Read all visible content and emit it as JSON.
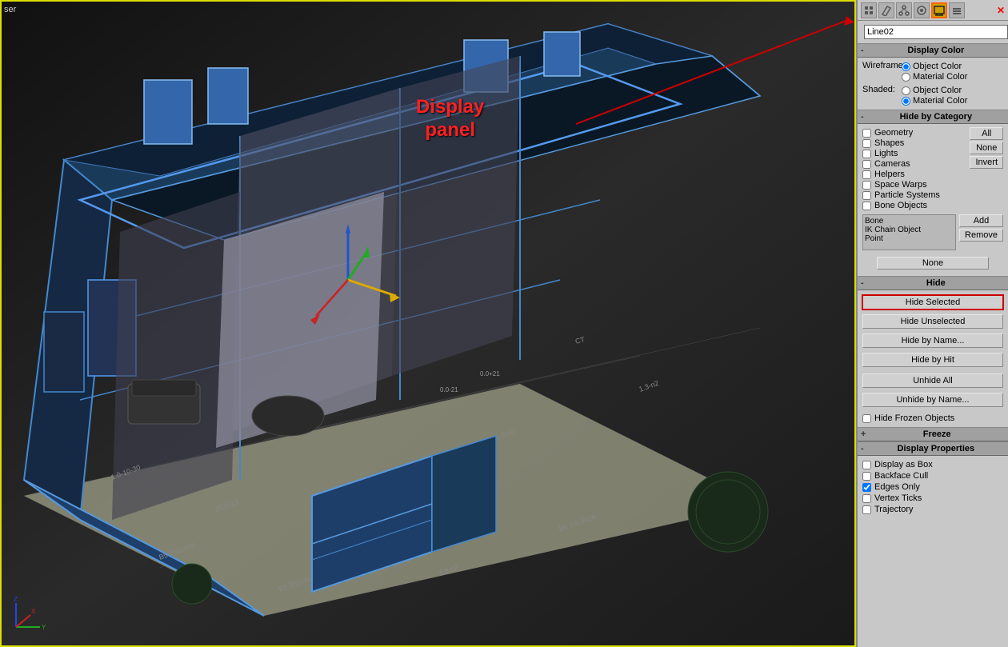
{
  "viewport": {
    "label": "ser"
  },
  "right_panel": {
    "toolbar": {
      "icons": [
        {
          "name": "create-icon",
          "symbol": "⬛",
          "active": false
        },
        {
          "name": "modify-icon",
          "symbol": "🔧",
          "active": false
        },
        {
          "name": "hierarchy-icon",
          "symbol": "⊞",
          "active": false
        },
        {
          "name": "motion-icon",
          "symbol": "◉",
          "active": false
        },
        {
          "name": "display-icon",
          "symbol": "▣",
          "active": true
        },
        {
          "name": "utilities-icon",
          "symbol": "🔨",
          "active": false
        }
      ]
    },
    "object_name": "Line02",
    "display_color": {
      "header": "Display Color",
      "wireframe_label": "Wireframe:",
      "wireframe_options": [
        {
          "label": "Object Color",
          "checked": true
        },
        {
          "label": "Material Color",
          "checked": false
        }
      ],
      "shaded_label": "Shaded:",
      "shaded_options": [
        {
          "label": "Object Color",
          "checked": false
        },
        {
          "label": "Material Color",
          "checked": true
        }
      ]
    },
    "hide_by_category": {
      "header": "Hide by Category",
      "checkboxes": [
        {
          "label": "Geometry",
          "checked": false
        },
        {
          "label": "Shapes",
          "checked": false
        },
        {
          "label": "Lights",
          "checked": false
        },
        {
          "label": "Cameras",
          "checked": false
        },
        {
          "label": "Helpers",
          "checked": false
        },
        {
          "label": "Space Warps",
          "checked": false
        },
        {
          "label": "Particle Systems",
          "checked": false
        },
        {
          "label": "Bone Objects",
          "checked": false
        }
      ],
      "buttons": {
        "all": "All",
        "none": "None",
        "invert": "Invert"
      },
      "bone_labels": [
        "Bone",
        "IK Chain Object",
        "Point"
      ],
      "add_btn": "Add",
      "remove_btn": "Remove",
      "none_btn": "None"
    },
    "hide_section": {
      "header": "Hide",
      "buttons": [
        {
          "label": "Hide Selected",
          "highlighted": true
        },
        {
          "label": "Hide Unselected",
          "highlighted": false
        },
        {
          "label": "Hide by Name...",
          "highlighted": false
        },
        {
          "label": "Hide by Hit",
          "highlighted": false
        },
        {
          "label": "Unhide All",
          "highlighted": false
        },
        {
          "label": "Unhide by Name...",
          "highlighted": false
        }
      ],
      "freeze_objects_label": "Hide Frozen Objects",
      "freeze_objects_checked": false
    },
    "freeze_section": {
      "header": "Freeze",
      "sign": "+"
    },
    "display_properties": {
      "header": "Display Properties",
      "sign": "-",
      "checkboxes": [
        {
          "label": "Display as Box",
          "checked": false
        },
        {
          "label": "Backface Cull",
          "checked": false
        },
        {
          "label": "Edges Only",
          "checked": true
        },
        {
          "label": "Vertex Ticks",
          "checked": false
        },
        {
          "label": "Trajectory",
          "checked": false
        }
      ]
    }
  },
  "annotation": {
    "text_line1": "Display",
    "text_line2": "panel"
  }
}
